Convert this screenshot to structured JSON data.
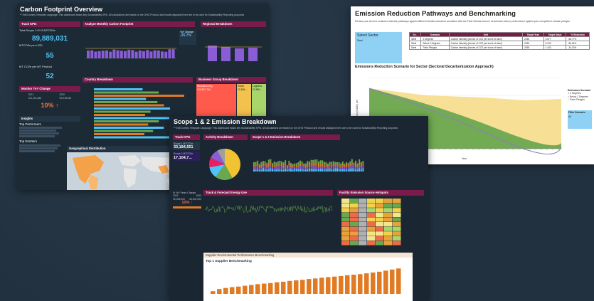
{
  "carbon": {
    "title": "Carbon Footprint Overview",
    "subtitle": "** Edit Dummy Template Language: This dashboard tracks key Sustainability KPIs. All calculations are based on the GHG Protocol and results displayed here are to be used for Sustainability Reporting purposes",
    "kpi_header": "Track KPIs",
    "total_label": "Total Scope 1+2+3 MTCO2e",
    "total_value": "89,889,031",
    "mtco2e_usd_label": "MTCO2e per USD",
    "mtco2e_usd_value": "55",
    "mt_product_label": "MT CO2e per MT Product",
    "mt_product_value": "52",
    "monthly_header": "Analyze Monthly Carbon Footprint",
    "yoy_header": "YoY Change",
    "yoy_value": "-35.7%",
    "regional_header": "Regional Breakdown",
    "country_header": "Country Breakdown",
    "business_header": "Business Group Breakdown",
    "bg_labels": [
      "Manufacturing",
      "Retail",
      "Logistics"
    ],
    "bg_values": [
      "109,557,754",
      "22,869,...",
      "22,869,..."
    ],
    "monitor_header": "Monitor YoY Change",
    "monitor_cols": [
      "2021",
      "2020"
    ],
    "monitor_vals": [
      "101,101,844",
      "91,918,032"
    ],
    "monitor_change": "10% ↑",
    "insights_header": "Insights",
    "top_perf_label": "Top Performers",
    "top_emit_label": "Top Emitters",
    "geo_header": "Geographical Distribution"
  },
  "scope": {
    "title": "Scope 1 & 2 Emission Breakdown",
    "subtitle": "** Edit Dummy Template Language: This dashboard tracks key Sustainability KPIs. All calculations are based on the GHG Protocol and results displayed here are to be used for Sustainability Reporting purposes",
    "kpi_header": "Track KPIs",
    "s1_label": "Scope 1 MTCO2e",
    "s1_value": "33,184,551",
    "s2_label": "Scope 2 MTCO2e",
    "s2_value": "17,104,7...",
    "yoy_label": "% YoY Years Change",
    "yoy_cols": [
      "2021",
      "2020"
    ],
    "yoy_vals": [
      "39,008,300",
      "35,004,000"
    ],
    "yoy_change": "10% ↑",
    "activity_header": "Activity Breakdown",
    "breakdown_header": "Scope 1 & 2 Emission Breakdown",
    "energy_header": "Track & Forecast Energy Use",
    "hotspot_header": "Facility Emission Source Hotspots"
  },
  "supplier": {
    "header": "Supplier Environmental Performance Benchmarking",
    "subheader": "Top 1 Supplier Benchmarking",
    "values": [
      10,
      18,
      22,
      25,
      27,
      30,
      33,
      36,
      38,
      40,
      43,
      45,
      48,
      50,
      52,
      55,
      57,
      60,
      62,
      64,
      66,
      69,
      71,
      73,
      76,
      79,
      82,
      86,
      90,
      94
    ]
  },
  "reduction": {
    "title": "Emission Reduction Pathways and Benchmarking",
    "subtitle": "Review your sector's emission reduction pathways against different climate scenarios consistent with the Paris Climate Accord; benchmark carbon performance against your competitor's climate pledges",
    "select_label": "Select Sector",
    "select_value": "Steel",
    "table_headers": [
      "Se...",
      "Scenario",
      "Unit",
      "Target Year",
      "Target Value",
      "% Reduction"
    ],
    "table_rows": [
      [
        "Steel",
        "2 Degrees",
        "Carbon intensity (tonnes of CO2 per tonne of steel)",
        "2050",
        "0.677",
        "-56.77%"
      ],
      [
        "Steel",
        "Below 2 Degrees",
        "Carbon intensity (tonnes of CO2 per tonne of steel)",
        "2050",
        "0.243",
        "-84.24%"
      ],
      [
        "Steel",
        "Paris Pledges",
        "Carbon intensity (tonnes of CO2 per tonne of steel)",
        "2050",
        "1.443",
        "-34.13%"
      ]
    ],
    "chart_title": "Emissions Reduction Scenario for Sector (Sectoral Decarbonization Approach)",
    "legend_title": "Emissions Scenario",
    "legend_items": [
      "2 Degrees",
      "Below 2 Degrees",
      "Paris Pledges"
    ],
    "ylabel": "Carbon Intensity (CO2e) per",
    "xlabel": "Year",
    "filter_label": "Filter Scenario",
    "filter_value": "All"
  },
  "colors": {
    "header": "#7a1b4b",
    "accent": "#4fc3f7",
    "bars": "#8a5cd6",
    "green": "#6aa84f",
    "yellow": "#f1c232",
    "orange": "#e07b24"
  }
}
